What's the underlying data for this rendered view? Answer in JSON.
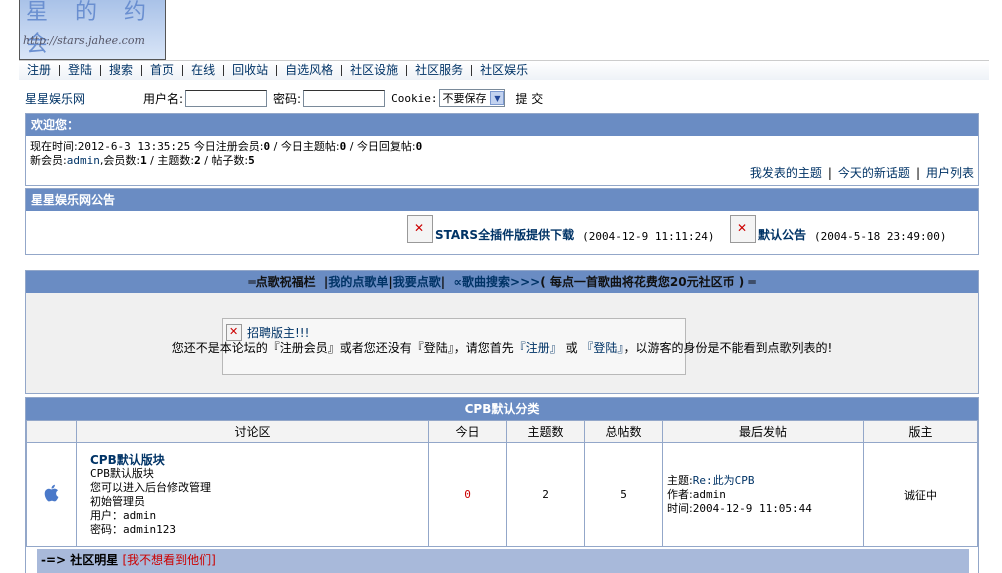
{
  "logo": {
    "title_chars": "星 的 约会",
    "url": "http://stars.jahee.com"
  },
  "nav": [
    "注册",
    "登陆",
    "搜索",
    "首页",
    "在线",
    "回收站",
    "自选风格",
    "社区设施",
    "社区服务",
    "社区娱乐"
  ],
  "login": {
    "site_name": "星星娱乐网",
    "username_label": "用户名:",
    "password_label": "密码:",
    "cookie_label": "Cookie:",
    "cookie_option": "不要保存",
    "submit_label": "提 交"
  },
  "welcome": {
    "title": "欢迎您：",
    "now_label": "现在时间:",
    "now_value": "2012-6-3 13:35:25",
    "today_reg_label": "今日注册会员:",
    "today_reg": "0",
    "today_topics_label": "今日主题帖:",
    "today_topics": "0",
    "today_replies_label": "今日回复帖:",
    "today_replies": "0",
    "newmember_label": "新会员:",
    "newmember": "admin",
    "members_label": "会员数:",
    "members": "1",
    "topics_label": "主题数:",
    "topics": "2",
    "posts_label": "帖子数:",
    "posts": "5",
    "links": [
      "我发表的主题",
      "今天的新话题",
      "用户列表"
    ]
  },
  "notice": {
    "title": "星星娱乐网公告",
    "items": [
      {
        "title": "STARS全插件版提供下载",
        "date": "(2004-12-9 11:11:24)"
      },
      {
        "title": "默认公告",
        "date": "(2004-5-18 23:49:00)"
      }
    ]
  },
  "songbar": {
    "prefix": "═点歌祝福栏",
    "my_list": "我的点歌单",
    "request": "我要点歌",
    "search": "∝歌曲搜索>>>",
    "suffix": "( 每点一首歌曲将花费您20元社区币 ) ═",
    "recruit": "招聘版主!!!",
    "msg_1": "您还不是本论坛的『注册会员』或者您还没有『登陆』，请您首先",
    "msg_reg": "『注册』",
    "msg_or": " 或 ",
    "msg_login": "『登陆』",
    "msg_2": "，以游客的身份是不能看到点歌列表的!"
  },
  "forum": {
    "category": "CPB默认分类",
    "headers": [
      "讨论区",
      "今日",
      "主题数",
      "总帖数",
      "最后发帖",
      "版主"
    ],
    "board": {
      "name": "CPB默认版块",
      "desc": [
        "CPB默认版块",
        "您可以进入后台修改管理",
        "初始管理员",
        "用户：admin",
        "密码：admin123"
      ],
      "today": "0",
      "topics": "2",
      "posts": "5",
      "last_topic_label": "主题:",
      "last_topic": "Re:此为CPB",
      "last_author_label": "作者:",
      "last_author": "admin",
      "last_time_label": "时间:",
      "last_time": "2004-12-9 11:05:44",
      "moderator": "诚征中"
    }
  },
  "stars": {
    "label": "-=> 社区明星",
    "hide": "[我不想看到他们]"
  },
  "colors": {
    "header_blue": "#6a8cc3",
    "link": "#003366",
    "today_red": "#cc0000"
  }
}
